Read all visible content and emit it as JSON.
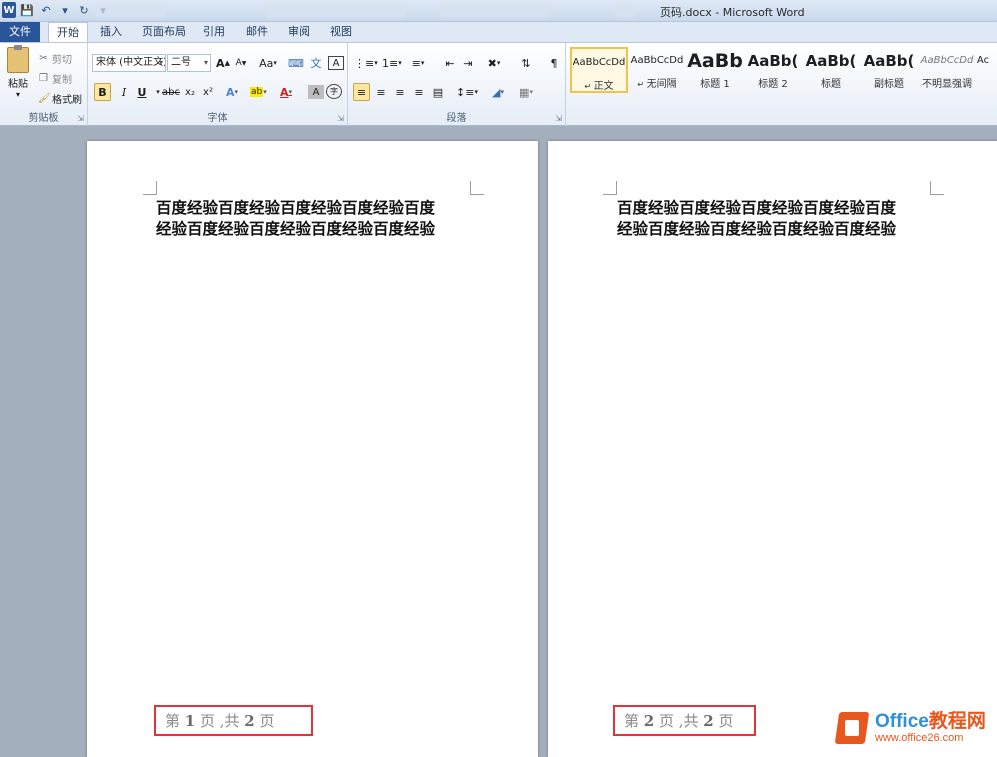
{
  "window": {
    "title": "页码.docx - Microsoft Word",
    "app_logo": "W"
  },
  "tabs": [
    "文件",
    "开始",
    "插入",
    "页面布局",
    "引用",
    "邮件",
    "审阅",
    "视图"
  ],
  "active_tab": "开始",
  "clipboard": {
    "paste": "粘贴",
    "cut": "剪切",
    "copy": "复制",
    "format_painter": "格式刷",
    "group_label": "剪贴板"
  },
  "font": {
    "name": "宋体 (中文正文)",
    "size": "二号",
    "grow": "A",
    "shrink": "A",
    "change_case": "Aa",
    "bold": "B",
    "italic": "I",
    "underline": "U",
    "strike": "abc",
    "subscript": "x₂",
    "superscript": "x²",
    "char_border": "A",
    "char_shading": "A",
    "enclose": "字",
    "group_label": "字体"
  },
  "paragraph": {
    "group_label": "段落"
  },
  "styles": [
    {
      "sample": "AaBbCcDd",
      "name": "正文",
      "active": true
    },
    {
      "sample": "AaBbCcDd",
      "name": "无间隔",
      "active": false
    },
    {
      "sample": "AaBb",
      "name": "标题 1",
      "active": false
    },
    {
      "sample": "AaBb(",
      "name": "标题 2",
      "active": false
    },
    {
      "sample": "AaBb(",
      "name": "标题",
      "active": false
    },
    {
      "sample": "AaBb(",
      "name": "副标题",
      "active": false
    },
    {
      "sample": "AaBbCcDd",
      "name": "不明显强调",
      "active": false
    },
    {
      "sample": "Ac",
      "name": "",
      "active": false
    }
  ],
  "pages": [
    {
      "line1": "百度经验百度经验百度经验百度经验百度",
      "line2": "经验百度经验百度经验百度经验百度经验",
      "footer_prefix": "第 ",
      "footer_num": "1",
      "footer_mid": " 页 ,共 ",
      "footer_total": "2",
      "footer_suffix": " 页"
    },
    {
      "line1": "百度经验百度经验百度经验百度经验百度",
      "line2": "经验百度经验百度经验百度经验百度经验",
      "footer_prefix": "第 ",
      "footer_num": "2",
      "footer_mid": " 页 ,共 ",
      "footer_total": "2",
      "footer_suffix": " 页"
    }
  ],
  "watermark": {
    "brand_a": "Office",
    "brand_b": "教程网",
    "url": "www.office26.com"
  }
}
